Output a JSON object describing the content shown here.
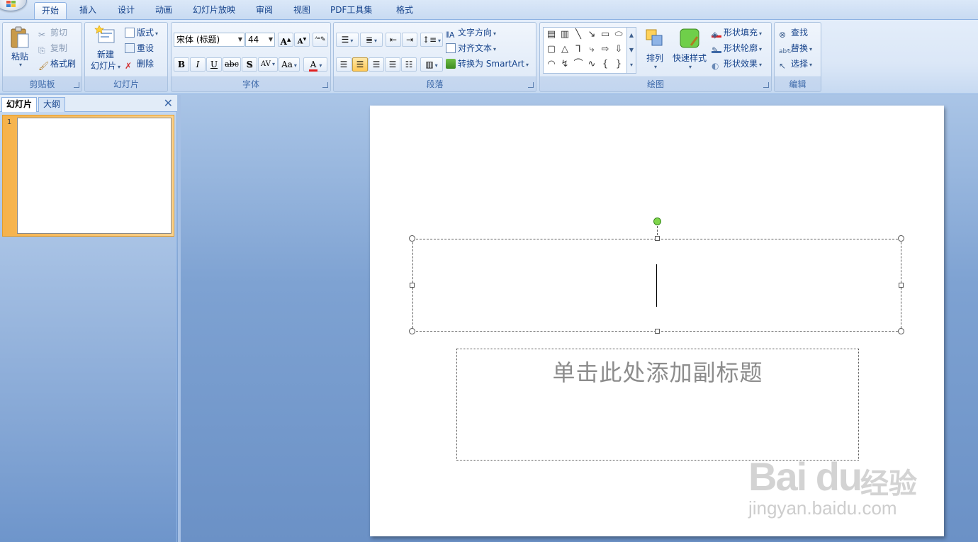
{
  "tabs": [
    {
      "label": "开始",
      "active": true
    },
    {
      "label": "插入"
    },
    {
      "label": "设计"
    },
    {
      "label": "动画"
    },
    {
      "label": "幻灯片放映"
    },
    {
      "label": "审阅"
    },
    {
      "label": "视图"
    },
    {
      "label": "PDF工具集"
    },
    {
      "label": "格式"
    }
  ],
  "clipboard": {
    "title": "剪贴板",
    "paste": "粘贴",
    "cut": "剪切",
    "copy": "复制",
    "format_painter": "格式刷"
  },
  "slides_group": {
    "title": "幻灯片",
    "new_slide_line1": "新建",
    "new_slide_line2": "幻灯片",
    "layout": "版式",
    "reset": "重设",
    "delete": "删除"
  },
  "font": {
    "title": "字体",
    "font_name": "宋体 (标题)",
    "font_size": "44",
    "grow": "A",
    "shrink": "A",
    "bold": "B",
    "italic": "I",
    "underline": "U",
    "strike": "abc",
    "shadow": "S",
    "spacing": "AV",
    "case": "Aa",
    "color": "A",
    "color_hex": "#e02020"
  },
  "paragraph": {
    "title": "段落",
    "text_direction": "文字方向",
    "align_text": "对齐文本",
    "convert_smartart": "转换为 SmartArt"
  },
  "drawing": {
    "title": "绘图",
    "arrange": "排列",
    "quick_styles": "快速样式",
    "shape_fill": "形状填充",
    "shape_outline": "形状轮廓",
    "shape_effects": "形状效果"
  },
  "editing": {
    "title": "编辑",
    "find": "查找",
    "replace": "替换",
    "select": "选择"
  },
  "pane": {
    "tab_slides": "幻灯片",
    "tab_outline": "大纲",
    "close": "✕",
    "slide_number": "1"
  },
  "slide": {
    "subtitle_placeholder": "单击此处添加副标题"
  },
  "watermark": {
    "brand": "Bai du",
    "cn": "经验",
    "url": "jingyan.baidu.com"
  },
  "colors": {
    "accent": "#15428b",
    "ribbon": "#dbe7f7",
    "selection_orange": "#f6b24a"
  }
}
